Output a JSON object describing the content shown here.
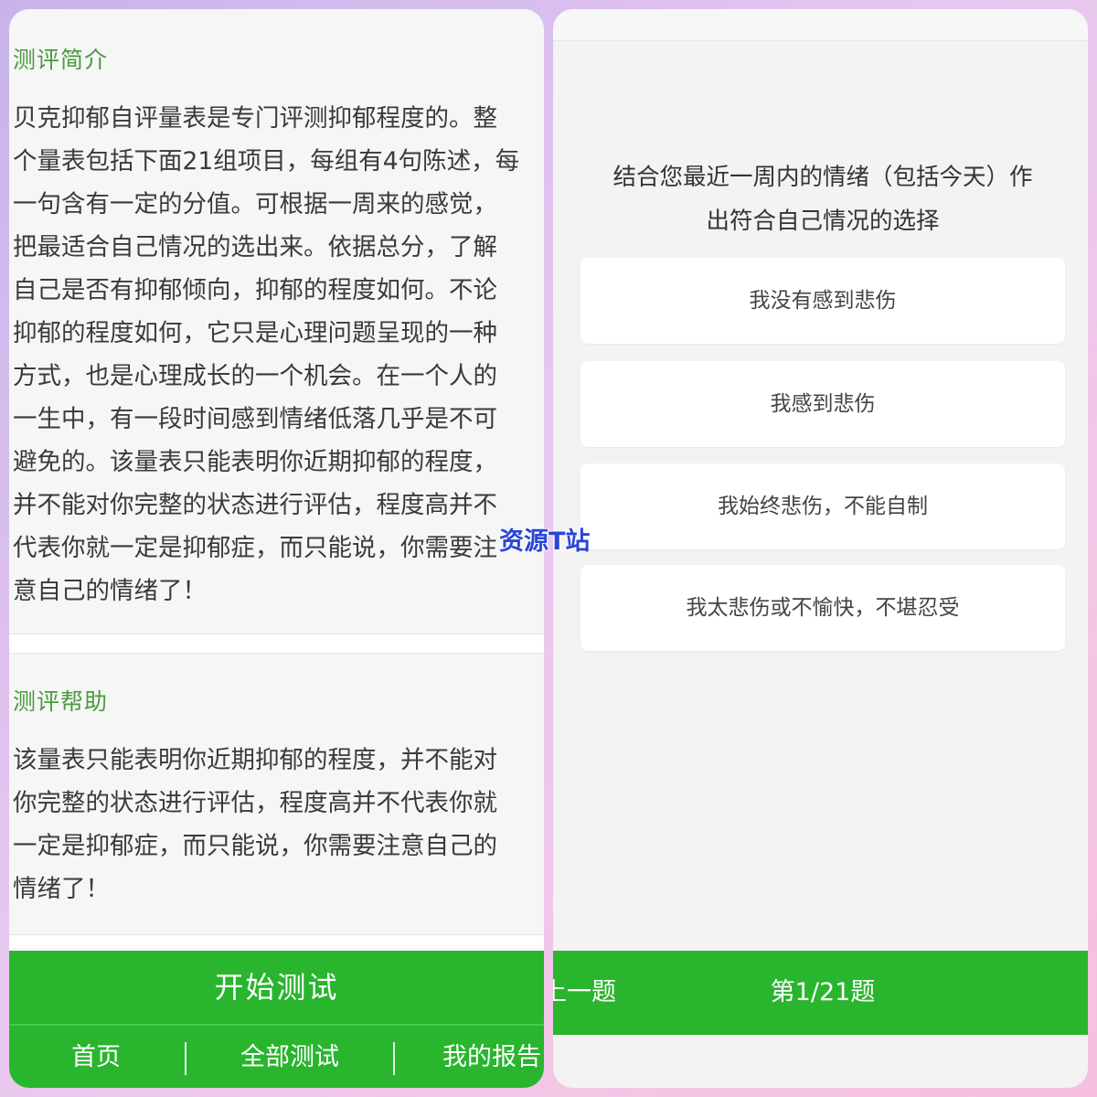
{
  "intro": {
    "title": "测评简介",
    "text": "贝克抑郁自评量表是专门评测抑郁程度的。整\n个量表包括下面21组项目，每组有4句陈述，每\n一句含有一定的分值。可根据一周来的感觉，\n把最适合自己情况的选出来。依据总分，了解\n自己是否有抑郁倾向，抑郁的程度如何。不论\n抑郁的程度如何，它只是心理问题呈现的一种\n方式，也是心理成长的一个机会。在一个人的\n一生中，有一段时间感到情绪低落几乎是不可\n避免的。该量表只能表明你近期抑郁的程度，\n并不能对你完整的状态进行评估，程度高并不\n代表你就一定是抑郁症，而只能说，你需要注\n意自己的情绪了！"
  },
  "help": {
    "title": "测评帮助",
    "text": "该量表只能表明你近期抑郁的程度，并不能对\n你完整的状态进行评估，程度高并不代表你就\n一定是抑郁症，而只能说，你需要注意自己的\n情绪了！"
  },
  "start_button": "开始测试",
  "nav": {
    "items": [
      "首页",
      "全部测试",
      "我的报告"
    ]
  },
  "quiz": {
    "question": "结合您最近一周内的情绪（包括今天）作\n出符合自己情况的选择",
    "options": [
      "我没有感到悲伤",
      "我感到悲伤",
      "我始终悲伤，不能自制",
      "我太悲伤或不愉快，不堪忍受"
    ],
    "prev_label": "上一题",
    "progress_label": "第1/21题"
  },
  "watermark": "资源T站",
  "colors": {
    "accent_green": "#29b52e",
    "title_green": "#4a9a3e",
    "watermark_blue": "#2a45d6"
  }
}
